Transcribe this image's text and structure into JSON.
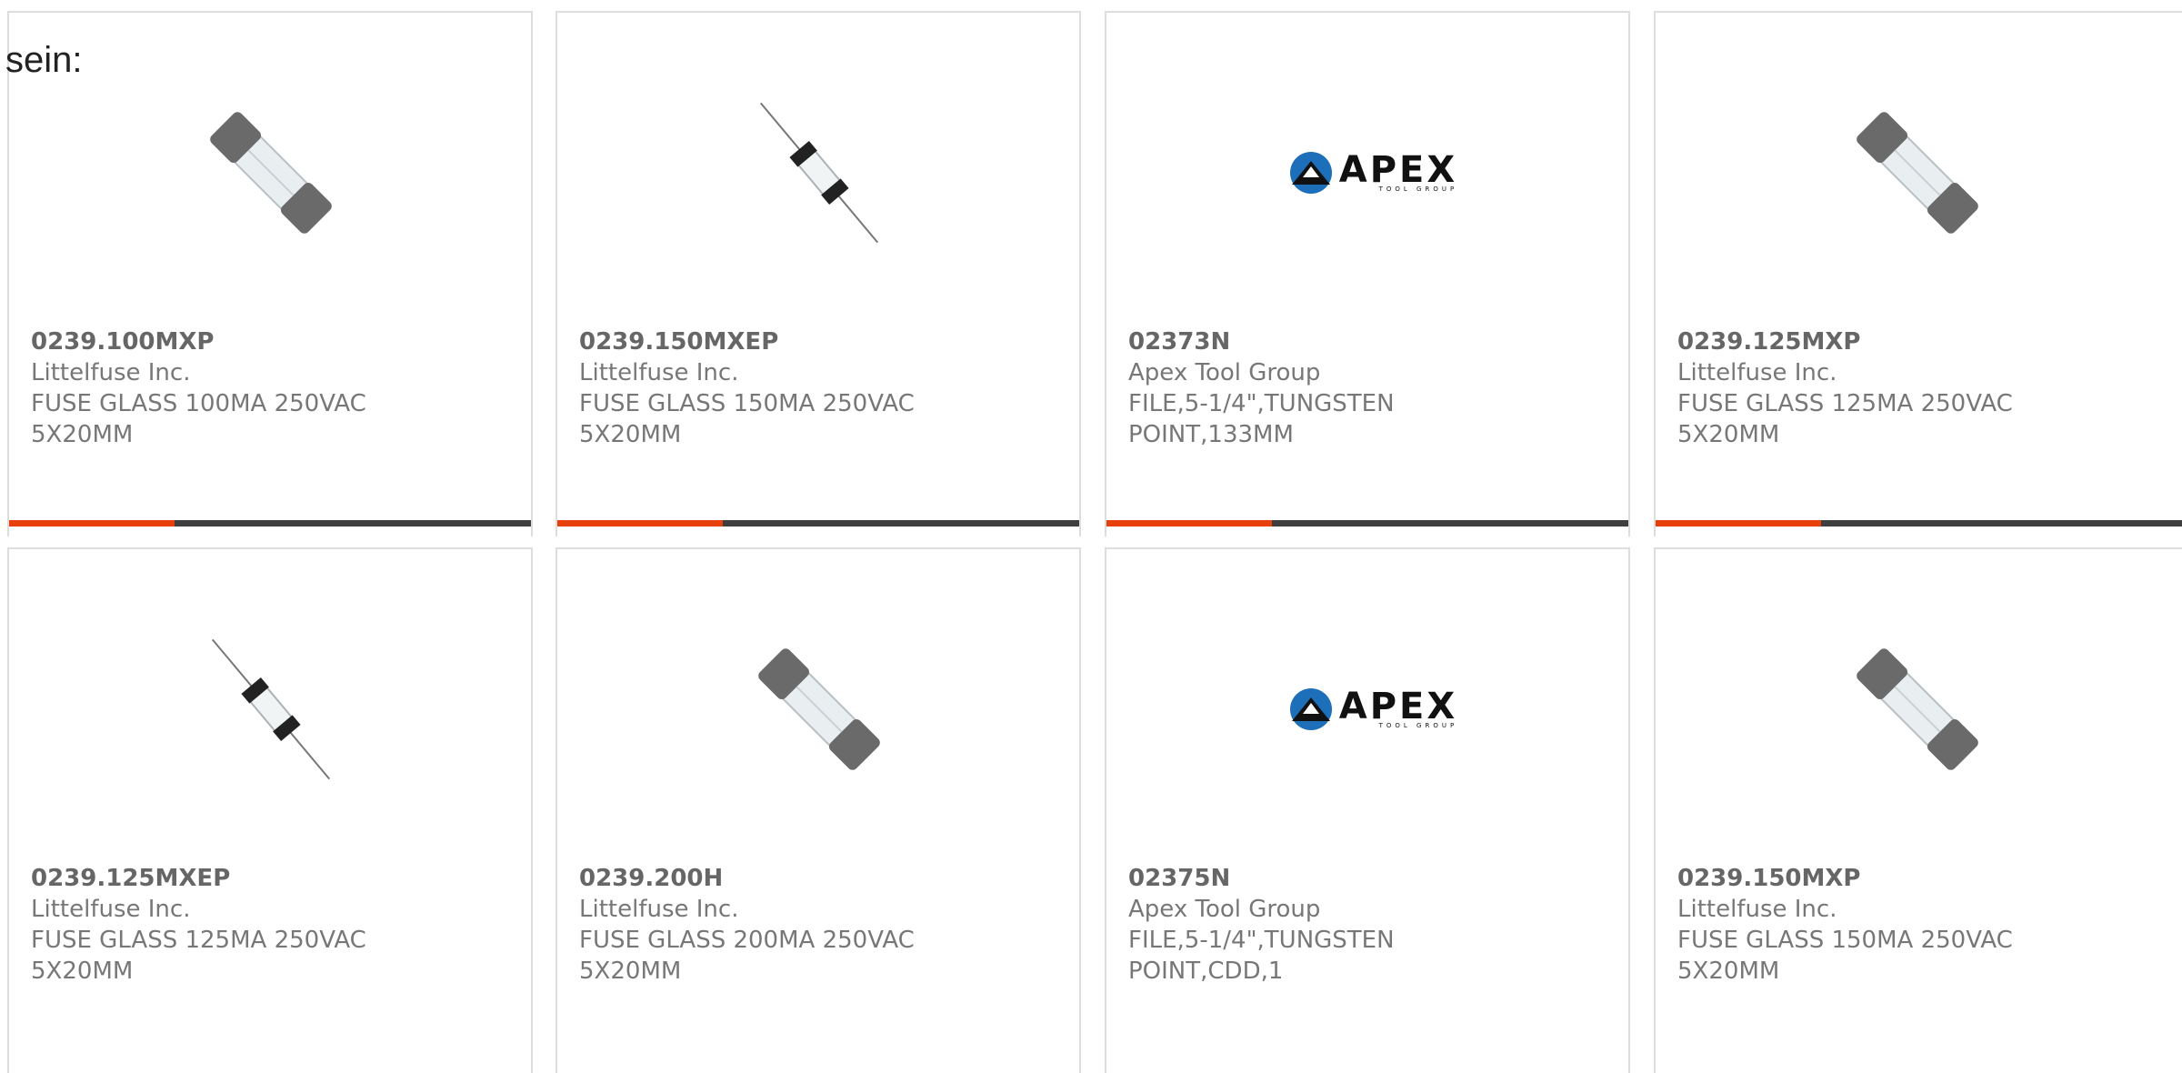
{
  "intro_text": "sein:",
  "products": [
    {
      "part": "0239.100MXP",
      "manufacturer": "Littelfuse Inc.",
      "desc_line1": "FUSE GLASS 100MA 250VAC",
      "desc_line2": "5X20MM",
      "image": "fuse-cartridge-icon"
    },
    {
      "part": "0239.150MXEP",
      "manufacturer": "Littelfuse Inc.",
      "desc_line1": "FUSE GLASS 150MA 250VAC",
      "desc_line2": "5X20MM",
      "image": "fuse-axial-icon"
    },
    {
      "part": "02373N",
      "manufacturer": "Apex Tool Group",
      "desc_line1": "FILE,5-1/4\",TUNGSTEN",
      "desc_line2": "POINT,133MM",
      "image": "apex-logo",
      "logo_word": "APEX",
      "logo_sub": "TOOL GROUP"
    },
    {
      "part": "0239.125MXP",
      "manufacturer": "Littelfuse Inc.",
      "desc_line1": "FUSE GLASS 125MA 250VAC",
      "desc_line2": "5X20MM",
      "image": "fuse-cartridge-icon"
    },
    {
      "part": "0239.125MXEP",
      "manufacturer": "Littelfuse Inc.",
      "desc_line1": "FUSE GLASS 125MA 250VAC",
      "desc_line2": "5X20MM",
      "image": "fuse-axial-icon"
    },
    {
      "part": "0239.200H",
      "manufacturer": "Littelfuse Inc.",
      "desc_line1": "FUSE GLASS 200MA 250VAC",
      "desc_line2": "5X20MM",
      "image": "fuse-cartridge-icon"
    },
    {
      "part": "02375N",
      "manufacturer": "Apex Tool Group",
      "desc_line1": "FILE,5-1/4\",TUNGSTEN",
      "desc_line2": "POINT,CDD,1",
      "image": "apex-logo",
      "logo_word": "APEX",
      "logo_sub": "TOOL GROUP"
    },
    {
      "part": "0239.150MXP",
      "manufacturer": "Littelfuse Inc.",
      "desc_line1": "FUSE GLASS 150MA 250VAC",
      "desc_line2": "5X20MM",
      "image": "fuse-cartridge-icon"
    }
  ],
  "colors": {
    "accent": "#e8400c",
    "bar": "#3e3e3e",
    "border": "#dddddd",
    "text": "#666666"
  }
}
